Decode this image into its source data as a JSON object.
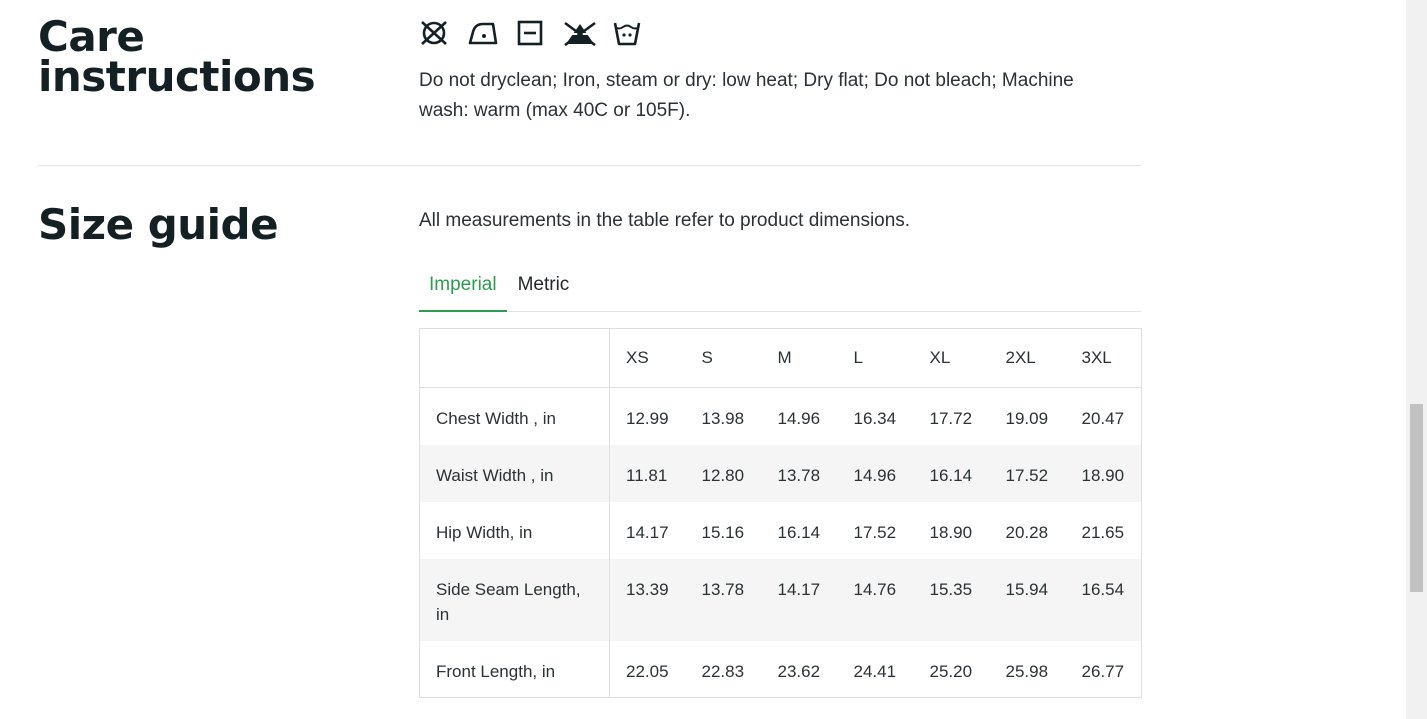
{
  "care": {
    "heading": "Care instructions",
    "icons": [
      "do-not-dryclean-icon",
      "iron-low-heat-icon",
      "dry-flat-icon",
      "do-not-bleach-icon",
      "machine-wash-warm-icon"
    ],
    "text": "Do not dryclean; Iron, steam or dry: low heat; Dry flat; Do not bleach; Machine wash: warm (max 40C or 105F)."
  },
  "size_guide": {
    "heading": "Size guide",
    "intro": "All measurements in the table refer to product dimensions.",
    "tabs": [
      {
        "label": "Imperial",
        "active": true
      },
      {
        "label": "Metric",
        "active": false
      }
    ],
    "table": {
      "columns": [
        "XS",
        "S",
        "M",
        "L",
        "XL",
        "2XL",
        "3XL"
      ],
      "rows": [
        {
          "label": "Chest Width , in",
          "values": [
            "12.99",
            "13.98",
            "14.96",
            "16.34",
            "17.72",
            "19.09",
            "20.47"
          ]
        },
        {
          "label": "Waist Width , in",
          "values": [
            "11.81",
            "12.80",
            "13.78",
            "14.96",
            "16.14",
            "17.52",
            "18.90"
          ]
        },
        {
          "label": "Hip Width, in",
          "values": [
            "14.17",
            "15.16",
            "16.14",
            "17.52",
            "18.90",
            "20.28",
            "21.65"
          ]
        },
        {
          "label": "Side Seam Length, in",
          "values": [
            "13.39",
            "13.78",
            "14.17",
            "14.76",
            "15.35",
            "15.94",
            "16.54"
          ]
        },
        {
          "label": "Front Length, in",
          "values": [
            "22.05",
            "22.83",
            "23.62",
            "24.41",
            "25.20",
            "25.98",
            "26.77"
          ]
        }
      ]
    }
  },
  "colors": {
    "accent": "#2c9c52",
    "heading": "#152025",
    "text": "#2b3134",
    "row_alt": "#f5f5f5"
  }
}
